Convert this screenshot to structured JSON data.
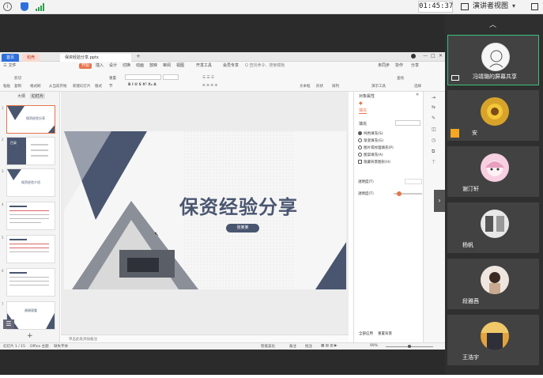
{
  "topbar": {
    "timer": "01:45:37",
    "presenter_view": "演讲者视图"
  },
  "wps": {
    "tabs": [
      {
        "label": "首页"
      },
      {
        "label": "稻壳"
      },
      {
        "label": "保资经验分享.pptx"
      }
    ],
    "menu": [
      "三 文件",
      "开始",
      "插入",
      "设计",
      "切换",
      "动画",
      "放映",
      "审阅",
      "视图",
      "开发工具",
      "会员专享",
      "Q 查找命令、搜索模板"
    ],
    "menu_right": [
      "未同步",
      "协作",
      "分享"
    ],
    "ribbon": {
      "paste": "粘贴",
      "cut": "剪切",
      "copy": "复制",
      "format_painter": "格式刷",
      "from_start": "从当前开始",
      "new_slide": "新建幻灯片",
      "layout": "版式",
      "section": "节",
      "reset": "重置",
      "font_size_label": "文本框",
      "shape": "形状",
      "arrange": "排列",
      "find": "查找",
      "select": "选择",
      "textbox": "文本框",
      "smart": "演示工具"
    },
    "thumb_tabs": [
      "大纲",
      "幻灯片"
    ],
    "thumbs": [
      "1",
      "2",
      "3",
      "4",
      "5",
      "6",
      "7"
    ],
    "thumb_texts": {
      "t1": "保资经验分享",
      "t2": "目录",
      "t3": "保资经验介绍",
      "t7": "谢谢观看"
    },
    "slide": {
      "title": "保资经验分享",
      "subtitle": "张某某"
    },
    "notes_hint": "单击此处添加备注",
    "format_pane": {
      "title": "对象属性",
      "tab": "填充",
      "section": "填充",
      "options": [
        "纯色填充(S)",
        "渐变填充(G)",
        "图片或纹理填充(P)",
        "图案填充(A)",
        "隐藏背景图形(H)"
      ],
      "opacity_label": "透明度(T)",
      "transparency_label": "透明度(T)",
      "apply_all": "全部应用",
      "reset_bg": "重置背景"
    },
    "status": {
      "slide_no": "幻灯片 1 / 15",
      "theme": "Office 主题",
      "missing_font": "缺失字体",
      "notes": "智能美化",
      "remarks": "备注",
      "comments": "批注",
      "zoom": "99%"
    }
  },
  "participants": [
    {
      "name": "冯靖璐的屏幕共享",
      "active": true
    },
    {
      "name": "安",
      "active": false
    },
    {
      "name": "谢汀轩",
      "active": false
    },
    {
      "name": "杨帆",
      "active": false
    },
    {
      "name": "段雅茜",
      "active": false
    },
    {
      "name": "王浩宇",
      "active": false
    }
  ],
  "colors": {
    "accent": "#39c27d",
    "slide_navy": "#4a5670",
    "wps_orange": "#e8744b"
  }
}
